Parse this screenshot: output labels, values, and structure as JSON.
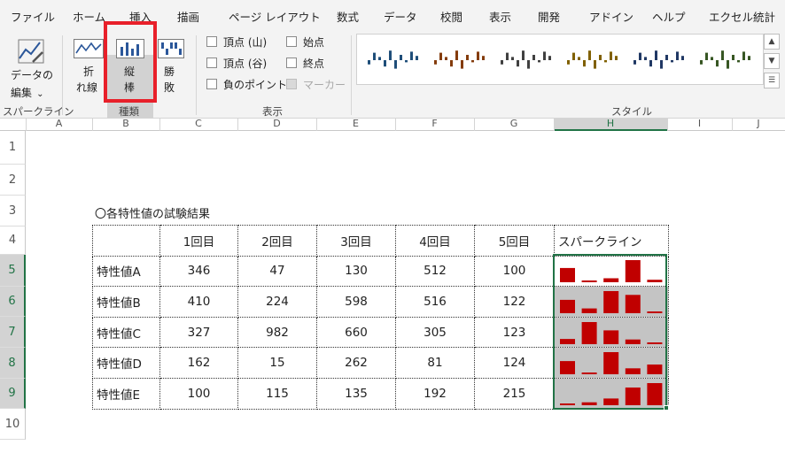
{
  "ribbon_tabs": [
    "ファイル",
    "ホーム",
    "挿入",
    "描画",
    "ページ レイアウト",
    "数式",
    "データ",
    "校閲",
    "表示",
    "開発",
    "アドイン",
    "ヘルプ",
    "エクセル統計"
  ],
  "ribbon": {
    "sparkline_group": {
      "edit_label_line1": "データの",
      "edit_label_line2": "編集",
      "dropdown_glyph": "⌄",
      "group_label": "スパークライン"
    },
    "type_group": {
      "line_line1": "折",
      "line_line2": "れ線",
      "column_line1": "縦",
      "column_line2": "棒",
      "winloss_line1": "勝",
      "winloss_line2": "敗",
      "group_label": "種類"
    },
    "show_group": {
      "high_point": "頂点 (山)",
      "low_point": "頂点 (谷)",
      "negative_points": "負のポイント",
      "first_point": "始点",
      "last_point": "終点",
      "markers": "マーカー",
      "group_label": "表示"
    },
    "style_group": {
      "group_label": "スタイル",
      "style_colors": [
        "#1f4e79",
        "#843c0c",
        "#404040",
        "#806000",
        "#203864",
        "#375623"
      ],
      "scroll_up": "▲",
      "scroll_down": "▼",
      "more": "☰"
    }
  },
  "columns": [
    "A",
    "B",
    "C",
    "D",
    "E",
    "F",
    "G",
    "H",
    "I",
    "J"
  ],
  "rows": [
    "1",
    "2",
    "3",
    "4",
    "5",
    "6",
    "7",
    "8",
    "9",
    "10"
  ],
  "caption": "〇各特性値の試験結果",
  "table": {
    "headers": [
      "1回目",
      "2回目",
      "3回目",
      "4回目",
      "5回目"
    ],
    "sparkline_header": "スパークライン",
    "rows": [
      {
        "label": "特性値A",
        "values": [
          346,
          47,
          130,
          512,
          100
        ]
      },
      {
        "label": "特性値B",
        "values": [
          410,
          224,
          598,
          516,
          122
        ]
      },
      {
        "label": "特性値C",
        "values": [
          327,
          982,
          660,
          305,
          123
        ]
      },
      {
        "label": "特性値D",
        "values": [
          162,
          15,
          262,
          81,
          124
        ]
      },
      {
        "label": "特性値E",
        "values": [
          100,
          115,
          135,
          192,
          215
        ]
      }
    ]
  },
  "sparkline_color": "#c00000"
}
